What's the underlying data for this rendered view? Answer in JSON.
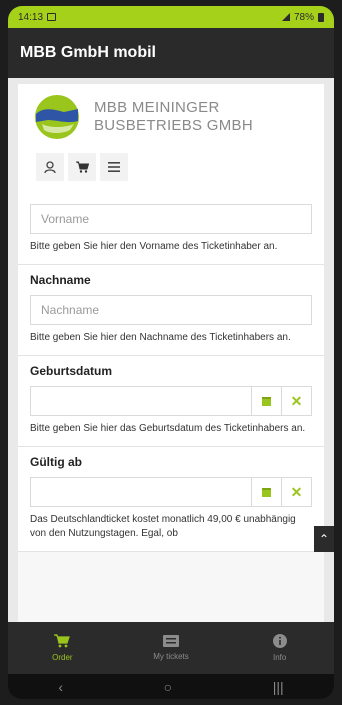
{
  "status_bar": {
    "time": "14:13",
    "battery": "78%"
  },
  "app_bar": {
    "title": "MBB GmbH mobil"
  },
  "brand": {
    "line1": "MBB MEININGER",
    "line2": "BUSBETRIEBS GMBH",
    "logo_colors": {
      "blue": "#2f56a6",
      "green": "#9ac51c"
    }
  },
  "toolbar": {
    "icons": [
      "user-icon",
      "cart-icon",
      "menu-icon"
    ]
  },
  "form": {
    "vorname": {
      "placeholder": "Vorname",
      "help": "Bitte geben Sie hier den Vorname des Ticketinhaber an."
    },
    "nachname": {
      "label": "Nachname",
      "placeholder": "Nachname",
      "help": "Bitte geben Sie hier den Nachname des Ticketinhabers an."
    },
    "geburtsdatum": {
      "label": "Geburtsdatum",
      "help": "Bitte geben Sie hier das Geburtsdatum des Ticketinhabers an."
    },
    "gueltig_ab": {
      "label": "Gültig ab",
      "help": "Das Deutschlandticket kostet monatlich 49,00 € unabhängig von den Nutzungstagen. Egal, ob"
    }
  },
  "bottom_nav": {
    "items": [
      {
        "label": "Order",
        "icon": "cart-icon",
        "active": true
      },
      {
        "label": "My tickets",
        "icon": "ticket-icon",
        "active": false
      },
      {
        "label": "Info",
        "icon": "info-icon",
        "active": false
      }
    ]
  },
  "colors": {
    "accent": "#9ac51c",
    "status_bar": "#a5d11a",
    "app_bar": "#2a2a2a"
  }
}
